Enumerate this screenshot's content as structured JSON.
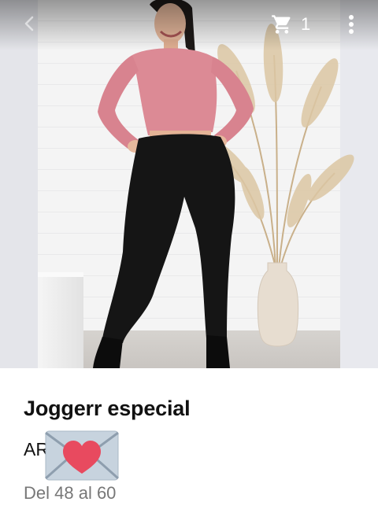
{
  "header": {
    "cart_count": "1",
    "icons": [
      "chevron-left-icon",
      "cart-icon",
      "more-vert-icon"
    ]
  },
  "product": {
    "image_alt": "Joggerr especial",
    "title": "Joggerr especial",
    "price": "AR          00",
    "sizes": "Del 48 al 60"
  },
  "overlay": {
    "emoji": "love-letter-icon"
  },
  "colors": {
    "accent": "#111111",
    "muted_text": "#777777",
    "heart": "#e84a5f",
    "envelope": "#c7d3de"
  }
}
